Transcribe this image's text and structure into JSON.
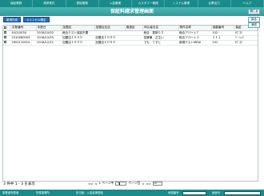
{
  "nav": [
    "保証業務",
    "請求受付",
    "督促業務",
    "入金管理",
    "カスタマー管理",
    "システム管理",
    "伝票出力",
    "ヘルプ"
  ],
  "title": "保証料請求管理画面",
  "close_label": "閉じる",
  "toolbar": {
    "new_label": "新規作成",
    "cancel_label": "キャンセル確定"
  },
  "side": {
    "search_label": "戻る",
    "clear_label": "消去"
  },
  "columns": [
    "",
    "手配番号",
    "手配日",
    "加盟店",
    "加盟店支店",
    "取扱区",
    "申込者氏名",
    "物件名称",
    "部屋番号",
    "保証"
  ],
  "rows": [
    [
      "",
      "A1010030",
      "2018/10/02",
      "総合テスト保証不要",
      "",
      "",
      "総合　更新０２",
      "総合アパート7",
      "102",
      "ｻﾌﾞｽｸ"
    ],
    [
      "",
      "2310080003",
      "2018/12/05",
      "加盟店１０００",
      "加盟店１０００",
      "",
      "突撃兼　正生い",
      "総合アパート１",
      "１１１",
      "ﾍﾞｰｼｯｸ"
    ],
    [
      "",
      "2902110010",
      "2018/12/21",
      "加盟店１０００",
      "加盟店１０００",
      "",
      "でも　てすと",
      "新規テストMEW",
      "101",
      "ｻﾌﾞｽｸ"
    ]
  ],
  "status": {
    "count_text": "3 件中 1 - 3 を表示"
  },
  "pager": {
    "first": "<<",
    "prev": "<",
    "page_prefix": "1 ページ中",
    "page_value": "1",
    "page_suffix": "ページ目",
    "next": ">",
    "last": ">>",
    "per_page": "10"
  },
  "bottom": {
    "office_label": "事業者所属者",
    "company_label": "所属事業所",
    "user_label": "担当者：入金者実務者",
    "field1_label": "承認番号",
    "field2_label": "画面ID"
  }
}
